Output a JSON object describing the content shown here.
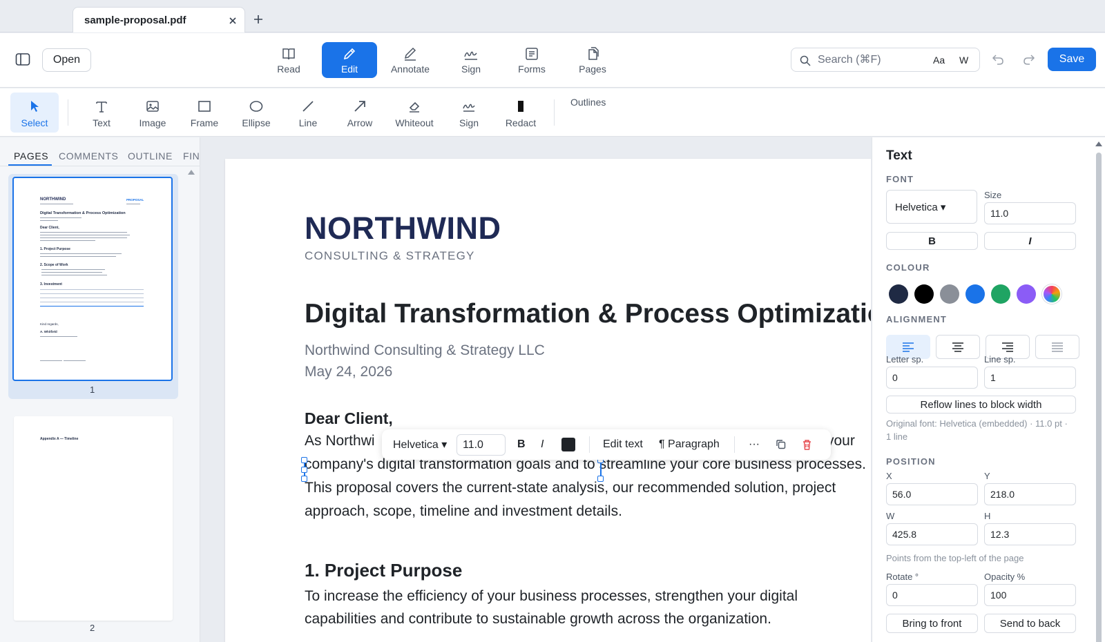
{
  "tab": {
    "title": "sample-proposal.pdf"
  },
  "toolbar": {
    "open_label": "Open",
    "modes": [
      {
        "label": "Read",
        "icon": "book-icon"
      },
      {
        "label": "Edit",
        "icon": "pencil-icon",
        "active": true
      },
      {
        "label": "Annotate",
        "icon": "pen-icon"
      },
      {
        "label": "Sign",
        "icon": "signature-icon"
      },
      {
        "label": "Forms",
        "icon": "form-icon"
      },
      {
        "label": "Pages",
        "icon": "pages-icon"
      }
    ],
    "search_placeholder": "Search (⌘F)",
    "match_case_label": "Aa",
    "whole_word_label": "W",
    "save_label": "Save",
    "accent_color": "#1a73e8"
  },
  "subtoolbar": {
    "tools": [
      {
        "label": "Select",
        "icon": "cursor-icon",
        "active": true
      },
      {
        "label": "Text",
        "icon": "text-icon"
      },
      {
        "label": "Image",
        "icon": "image-icon"
      },
      {
        "label": "Frame",
        "icon": "rectangle-icon"
      },
      {
        "label": "Ellipse",
        "icon": "ellipse-icon"
      },
      {
        "label": "Line",
        "icon": "line-icon"
      },
      {
        "label": "Arrow",
        "icon": "arrow-icon"
      },
      {
        "label": "Whiteout",
        "icon": "eraser-icon"
      },
      {
        "label": "Sign",
        "icon": "signature-icon"
      },
      {
        "label": "Redact",
        "icon": "redact-icon"
      }
    ],
    "outlines_label": "Outlines"
  },
  "leftpanel": {
    "tabs": [
      "PAGES",
      "COMMENTS",
      "OUTLINE",
      "FIN"
    ],
    "page_numbers": [
      "1",
      "2"
    ],
    "thumb1": {
      "brand": "NORTHWIND",
      "tag": "PROPOSAL",
      "title": "Digital Transformation & Process Optimization",
      "greeting": "Dear Client,",
      "s1": "1.  Project Purpose",
      "s2": "2.  Scope of Work",
      "s3": "3.  Investment",
      "closing": "Kind regards,",
      "signature": "A. Whitfield"
    },
    "thumb2": {
      "heading": "Appendix A — Timeline"
    }
  },
  "document": {
    "brand": "NORTHWIND",
    "brand_sub": "CONSULTING  &  STRATEGY",
    "title": "Digital Transformation & Process Optimization",
    "company": "Northwind Consulting & Strategy LLC",
    "date": "May 24, 2026",
    "salutation": "Dear Client,",
    "para1_line1_start": "As Northwi",
    "para1_line1_end": "your",
    "para1_line2": "company's digital transformation goals and to streamline your core business processes.",
    "para1_line3": "This proposal covers the current-state analysis, our recommended solution, project",
    "para1_line4": "approach, scope, timeline and investment details.",
    "section1": "1.  Project Purpose",
    "para2_line1": "To increase the efficiency of your business processes, strengthen your digital",
    "para2_line2": "capabilities and contribute to sustainable growth across the organization."
  },
  "floatbar": {
    "font": "Helvetica ▾",
    "size": "11.0",
    "bold": "B",
    "italic": "I",
    "text_color": "#1f2328",
    "edit_text": "Edit text",
    "paragraph": "¶ Paragraph",
    "more": "···",
    "delete_color": "#e5484d"
  },
  "rightpanel": {
    "title": "Text",
    "font_section": "FONT",
    "font_value": "Helvetica ▾",
    "size_label": "Size",
    "size_value": "11.0",
    "bold": "B",
    "italic": "I",
    "colour_section": "COLOUR",
    "colours": [
      "#1f2a44",
      "#000000",
      "#8a8f98",
      "#1a73e8",
      "#1fa463",
      "#8b5cf6"
    ],
    "alignment_section": "ALIGNMENT",
    "letter_sp_label": "Letter sp.",
    "letter_sp_value": "0",
    "line_sp_label": "Line sp.",
    "line_sp_value": "1",
    "reflow_label": "Reflow lines to block width",
    "original_font_note": "Original font: Helvetica (embedded) · 11.0 pt ·",
    "original_font_note2": "1 line",
    "position_section": "POSITION",
    "x_label": "X",
    "x_value": "56.0",
    "y_label": "Y",
    "y_value": "218.0",
    "w_label": "W",
    "w_value": "425.8",
    "h_label": "H",
    "h_value": "12.3",
    "points_note": "Points from the top-left of the page",
    "rotate_label": "Rotate °",
    "rotate_value": "0",
    "opacity_label": "Opacity %",
    "opacity_value": "100",
    "bring_front": "Bring to front",
    "send_back": "Send to back"
  }
}
